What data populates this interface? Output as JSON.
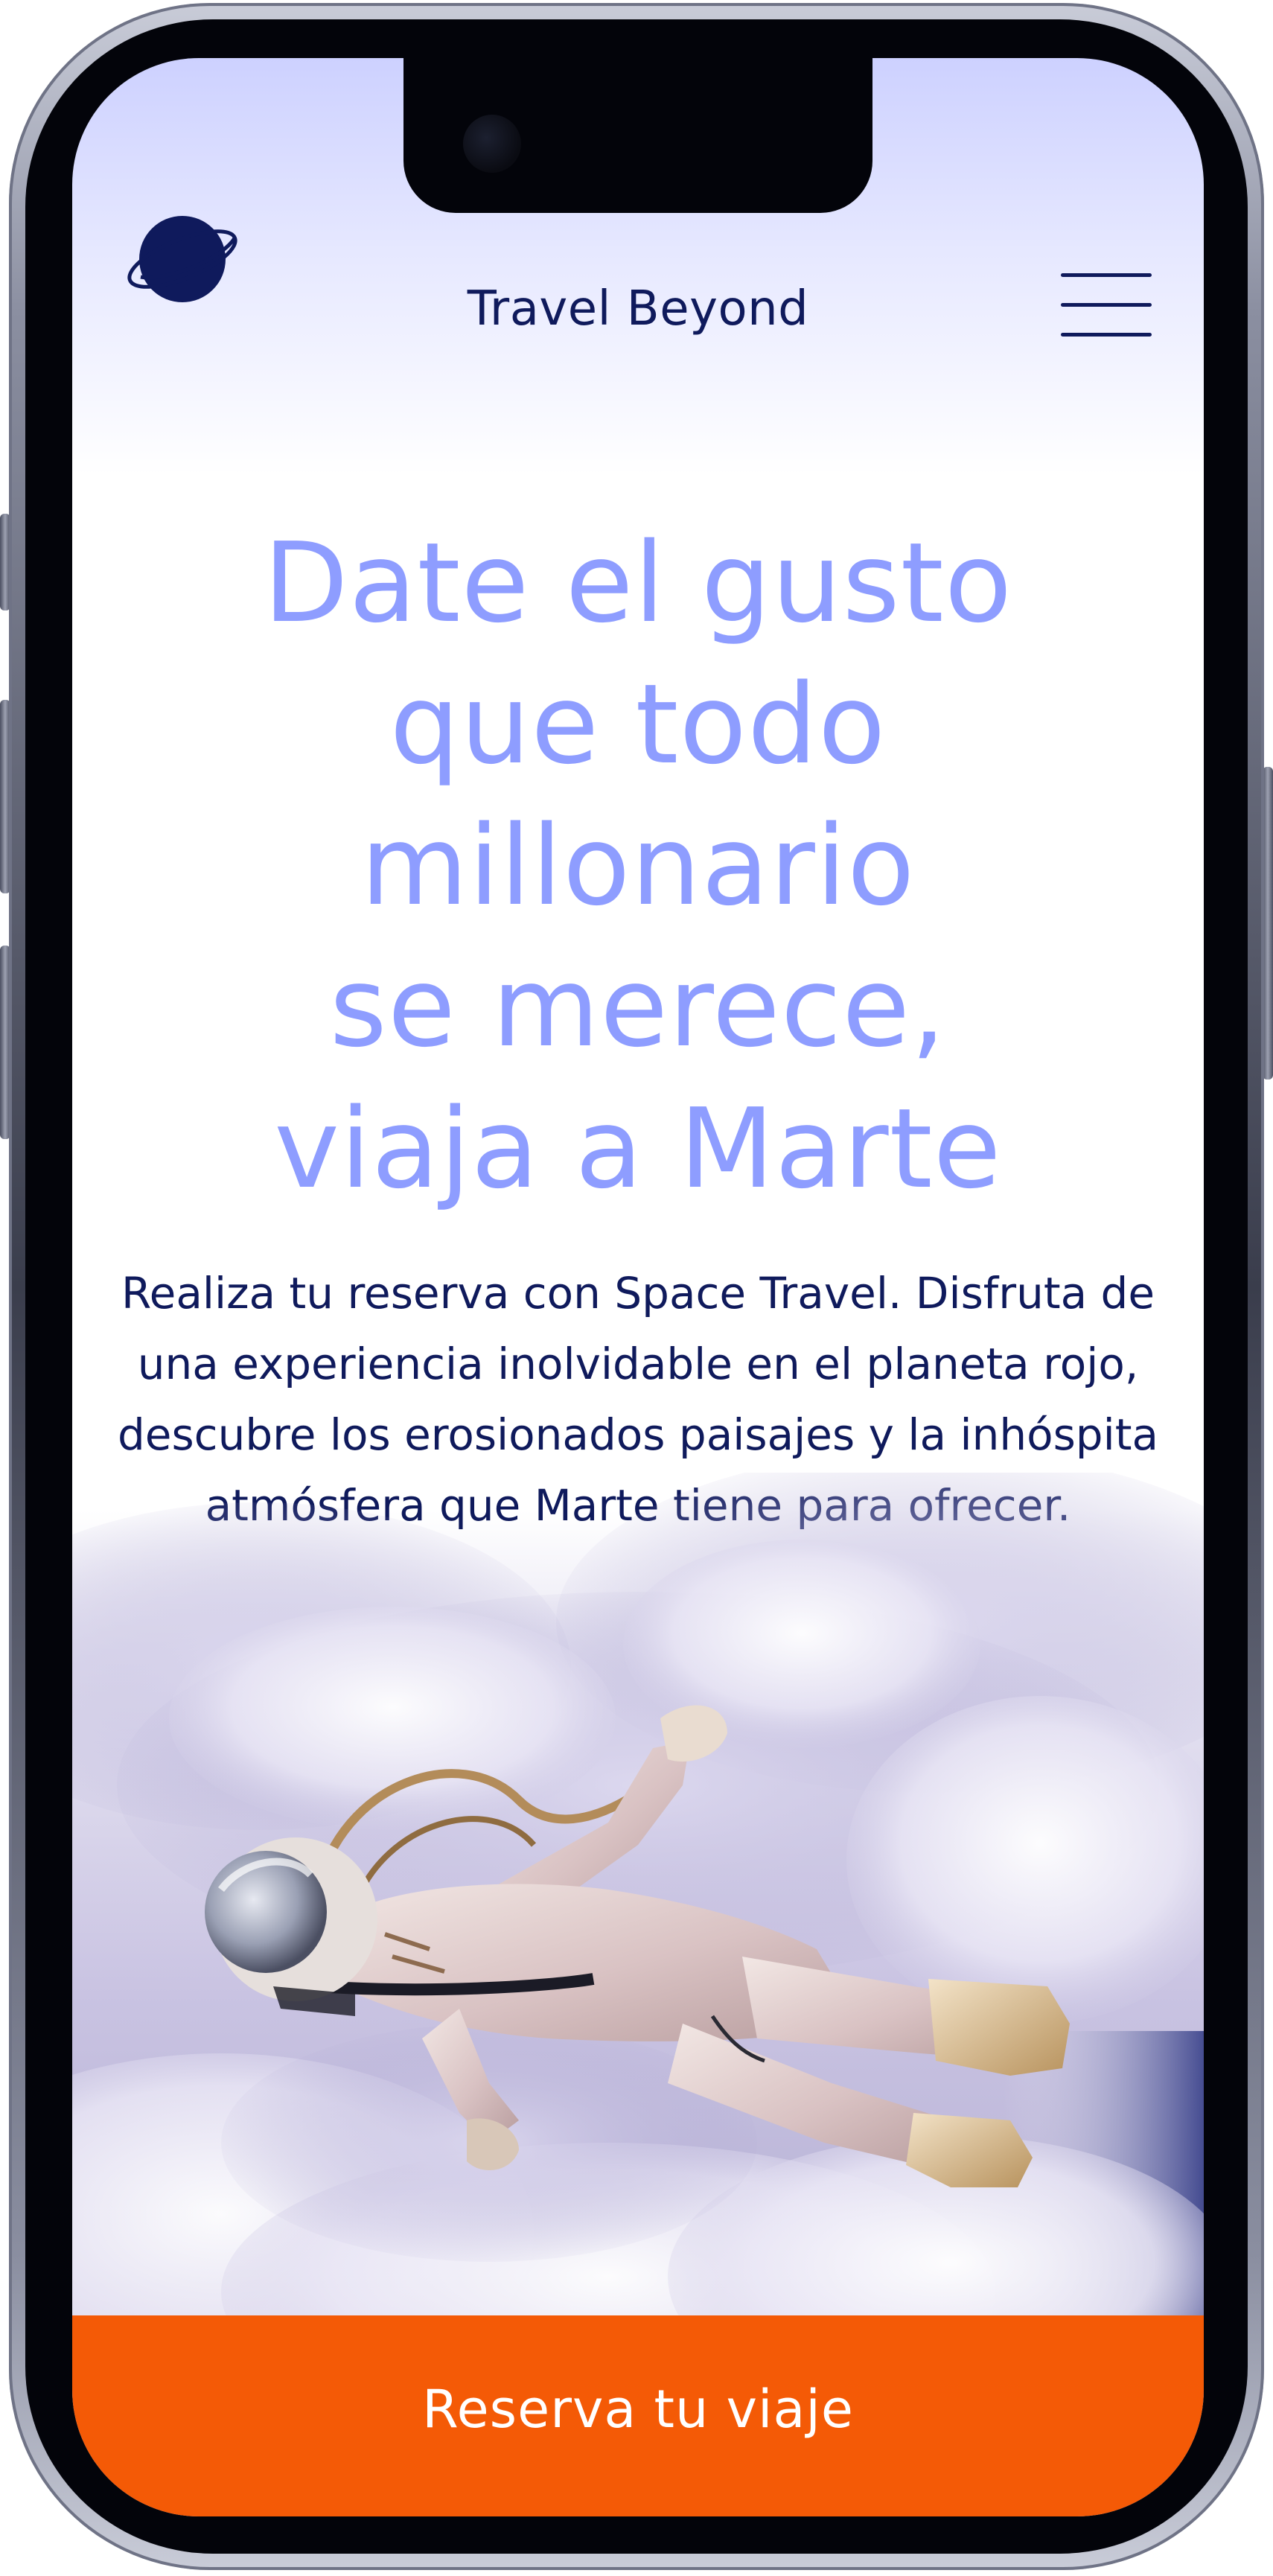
{
  "header": {
    "title": "Travel Beyond",
    "logo_icon": "planet-icon",
    "menu_icon": "hamburger-menu-icon"
  },
  "hero": {
    "headline": "Date el gusto\nque todo\nmillonario\nse merece,\nviaja a Marte",
    "description": "Realiza tu reserva con Space Travel. Disfruta de una experiencia inolvidable en el planeta rojo, descubre los erosionados paisajes y la inhóspita atmósfera que Marte tiene para ofrecer."
  },
  "cta": {
    "label": "Reserva tu viaje"
  },
  "colors": {
    "brand_dark": "#0f1a5c",
    "headline": "#8e9dff",
    "cta_background": "#f45a06",
    "cta_text": "#ffffff"
  }
}
